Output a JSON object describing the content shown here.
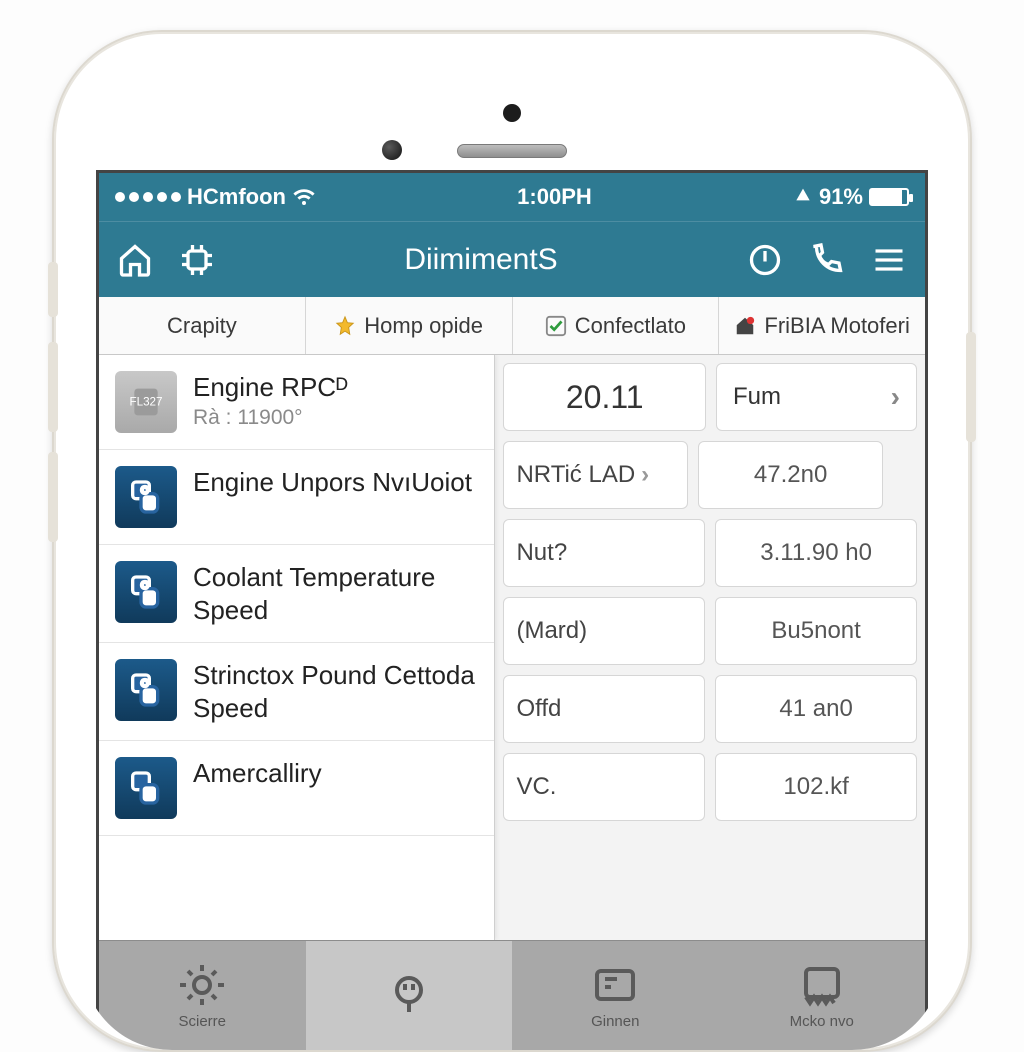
{
  "status": {
    "carrier": "HCmfoon",
    "time": "1:00PH",
    "battery": "91%"
  },
  "nav": {
    "title": "DiimimentS"
  },
  "tabs": [
    {
      "label": "Crapity"
    },
    {
      "label": "Homp opide"
    },
    {
      "label": "Confectlato"
    },
    {
      "label": "FriBIA Motoferi"
    }
  ],
  "list": [
    {
      "title": "Engine RPCᴰ",
      "sub": "Rà : 11900°"
    },
    {
      "title": "Engine Unpors NvıUoiot"
    },
    {
      "title": "Coolant Temperature Speed"
    },
    {
      "title": "Strinctox Pound Cettoda Speed"
    },
    {
      "title": "Amercalliry"
    }
  ],
  "right": {
    "big": "20.11",
    "selector": "Fum",
    "rows": [
      {
        "label": "NRTić LAD",
        "value": "47.2n0",
        "chev": true
      },
      {
        "label": "Nut?",
        "value": "3.11.90 h0"
      },
      {
        "label": "(Mard)",
        "value": "Bu5nont"
      },
      {
        "label": "Offd",
        "value": "41 an0"
      },
      {
        "label": "VC.",
        "value": "102.kf"
      }
    ]
  },
  "bottom": [
    "Scierre",
    "",
    "Ginnen",
    "Mcko nvo"
  ]
}
